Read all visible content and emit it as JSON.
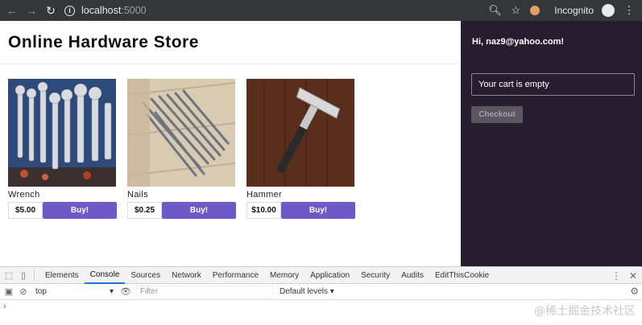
{
  "browser": {
    "url_host": "localhost",
    "url_port": ":5000",
    "incognito_label": "Incognito"
  },
  "store": {
    "title": "Online Hardware Store",
    "products": [
      {
        "name": "Wrench",
        "price": "$5.00",
        "buy_label": "Buy!"
      },
      {
        "name": "Nails",
        "price": "$0.25",
        "buy_label": "Buy!"
      },
      {
        "name": "Hammer",
        "price": "$10.00",
        "buy_label": "Buy!"
      }
    ]
  },
  "sidebar": {
    "greeting": "Hi, naz9@yahoo.com!",
    "cart_text": "Your cart is empty",
    "checkout_label": "Checkout"
  },
  "devtools": {
    "tabs": [
      "Elements",
      "Console",
      "Sources",
      "Network",
      "Performance",
      "Memory",
      "Application",
      "Security",
      "Audits",
      "EditThisCookie"
    ],
    "active_tab": "Console",
    "context": "top",
    "filter_placeholder": "Filter",
    "levels_label": "Default levels ▾",
    "prompt": "›"
  },
  "watermark": "@稀土掘金技术社区",
  "colors": {
    "accent": "#6e5ac6",
    "sidebar_bg": "#261d2f",
    "chrome_bg": "#35363a"
  }
}
